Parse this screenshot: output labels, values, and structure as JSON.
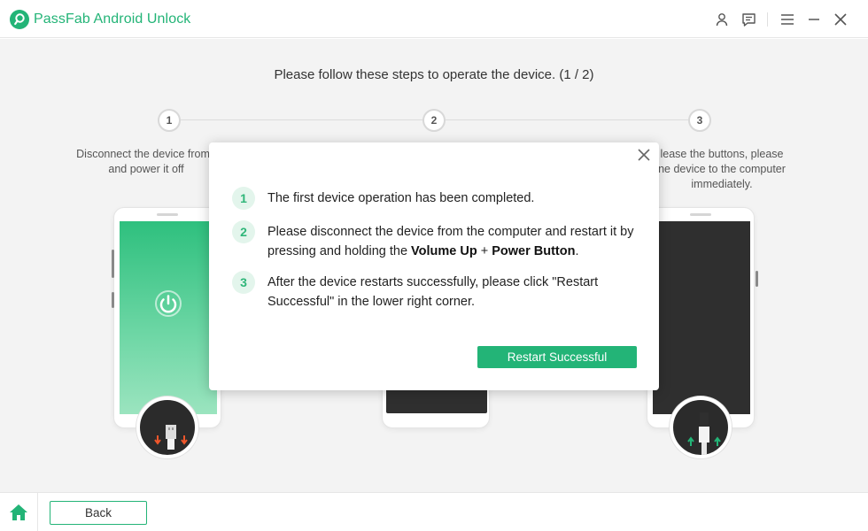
{
  "app": {
    "title": "PassFab Android Unlock",
    "brand_color": "#23b477"
  },
  "titlebar": {
    "icons": [
      "user-icon",
      "feedback-icon",
      "menu-icon",
      "minimize-icon",
      "close-icon"
    ]
  },
  "main": {
    "heading": "Please follow these steps to operate the device. (1 / 2)",
    "steps": [
      {
        "number": "1",
        "description": "Disconnect the device from t\nand power it off"
      },
      {
        "number": "2",
        "description": ""
      },
      {
        "number": "3",
        "description": "lease the buttons, please\nne device to the computer\nimmediately."
      }
    ]
  },
  "modal": {
    "items": [
      {
        "number": "1",
        "text": "The first device operation has been completed."
      },
      {
        "number": "2",
        "text_before": "Please disconnect the device from the computer and restart it by pressing and holding the ",
        "bold1": "Volume Up",
        "plus": " + ",
        "bold2": "Power Button",
        "text_after": "."
      },
      {
        "number": "3",
        "text": "After the device restarts successfully, please click \"Restart Successful\" in the lower right corner."
      }
    ],
    "button_label": "Restart Successful"
  },
  "footer": {
    "back_label": "Back"
  }
}
